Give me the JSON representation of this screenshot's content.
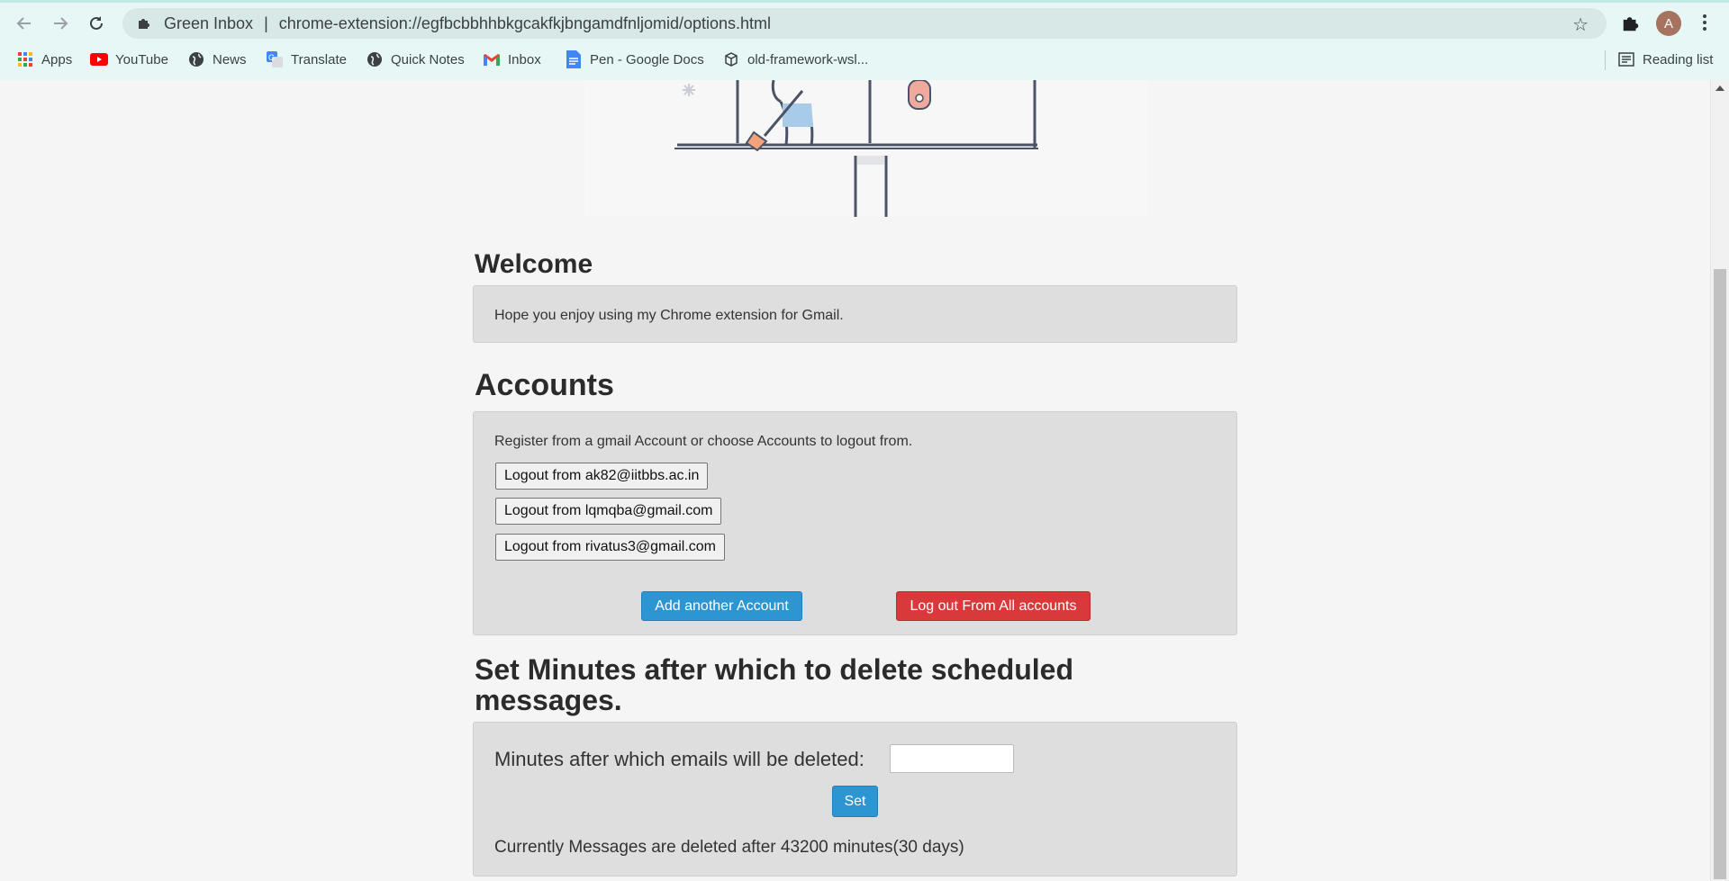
{
  "browser": {
    "extension_name": "Green Inbox",
    "url_separator": "|",
    "url": "chrome-extension://egfbcbbhhbkgcakfkjbngamdfnljomid/options.html",
    "avatar_letter": "A",
    "bookmarks": [
      {
        "label": "Apps",
        "icon": "apps-grid-icon"
      },
      {
        "label": "YouTube",
        "icon": "youtube-icon"
      },
      {
        "label": "News",
        "icon": "globe-icon"
      },
      {
        "label": "Translate",
        "icon": "translate-icon"
      },
      {
        "label": "Quick Notes",
        "icon": "globe-icon"
      },
      {
        "label": "Inbox",
        "icon": "gmail-icon"
      },
      {
        "label": "Pen - Google Docs",
        "icon": "docs-icon"
      },
      {
        "label": "old-framework-wsl...",
        "icon": "cube-icon"
      }
    ],
    "reading_list": "Reading list"
  },
  "welcome": {
    "title": "Welcome",
    "text": "Hope you enjoy using my Chrome extension for Gmail."
  },
  "accounts": {
    "title": "Accounts",
    "instructions": "Register from a gmail Account or choose Accounts to logout from.",
    "logout_buttons": [
      "Logout from ak82@iitbbs.ac.in",
      "Logout from lqmqba@gmail.com",
      "Logout from rivatus3@gmail.com"
    ],
    "add_label": "Add another Account",
    "logout_all_label": "Log out From All accounts"
  },
  "minutes": {
    "title": "Set Minutes after which to delete scheduled messages.",
    "label": "Minutes after which emails will be deleted:",
    "input_value": "",
    "set_label": "Set",
    "status": "Currently Messages are deleted after 43200 minutes(30 days)"
  },
  "colors": {
    "primary": "#2e95d3",
    "danger": "#d9393a",
    "chrome": "#e6f7f6"
  }
}
